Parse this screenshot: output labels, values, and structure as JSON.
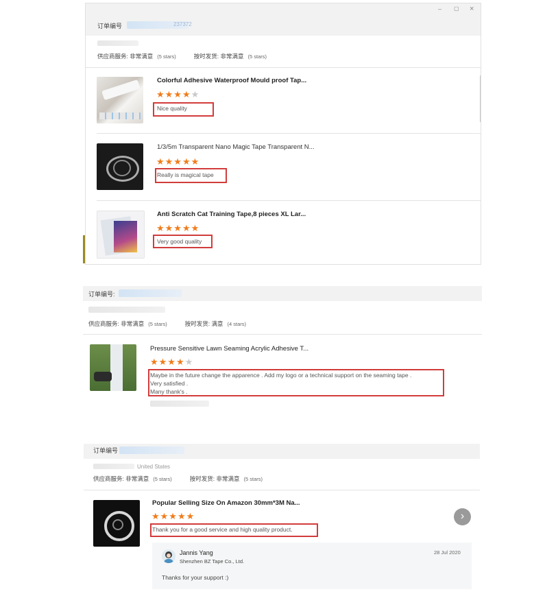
{
  "window_controls": {
    "minimize": "–",
    "maximize": "▢",
    "close": "×"
  },
  "order_label": "订单编号",
  "order1": {
    "order_number_partial": "237372",
    "supplier_service_label": "供应商服务: 非常满意",
    "supplier_service_stars": "(5 stars)",
    "shipping_label": "按时发货: 非常满意",
    "shipping_stars": "(5 stars)",
    "items": [
      {
        "title": "Colorful Adhesive Waterproof Mould proof Tap...",
        "rating": 4,
        "review": "Nice quality"
      },
      {
        "title": "1/3/5m Transparent Nano Magic Tape Transparent N...",
        "rating": 5,
        "review": "Really is magical tape"
      },
      {
        "title": "Anti Scratch Cat Training Tape,8 pieces XL Lar...",
        "rating": 5,
        "review": "Very good quality"
      }
    ]
  },
  "order2": {
    "order_label": "订单编号:",
    "supplier_service_label": "供应商服务: 非常满意",
    "supplier_service_stars": "(5 stars)",
    "shipping_label": "按时发货: 满意",
    "shipping_stars": "(4 stars)",
    "item": {
      "title": "Pressure Sensitive Lawn Seaming Acrylic Adhesive T...",
      "rating": 4,
      "review_lines": [
        "Maybe in the future change the apparence . Add my logo or a technical support on the seaming tape .",
        "Very satisfied .",
        "Many thank's ."
      ]
    }
  },
  "order3": {
    "country": "United States",
    "supplier_service_label": "供应商服务: 非常满意",
    "supplier_service_stars": "(5 stars)",
    "shipping_label": "按时发货: 非常满意",
    "shipping_stars": "(5 stars)",
    "item": {
      "title": "Popular Selling Size On Amazon 30mm*3M Na...",
      "rating": 5,
      "review": "Thank you for a good service and high quality product."
    },
    "reply": {
      "name": "Jannis Yang",
      "company": "Shenzhen BZ Tape Co., Ltd.",
      "date": "28 Jul 2020",
      "text": "Thanks for your support :)"
    },
    "next_icon": "›"
  },
  "colors": {
    "star": "#f07c1a",
    "star_off": "#c9c9c9",
    "highlight": "#d23b3b",
    "header_bg": "#f2f2f2"
  }
}
